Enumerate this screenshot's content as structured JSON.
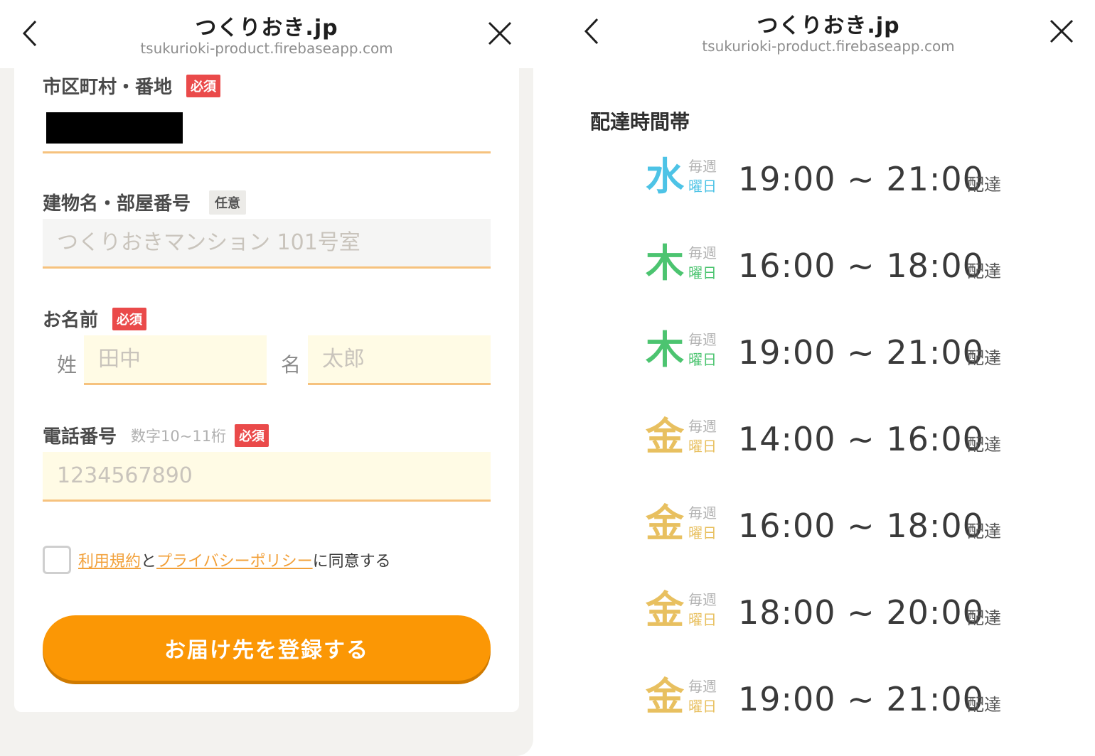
{
  "colors": {
    "accent": "#fb9705",
    "required_badge": "#ea4a4a",
    "input_border": "#f6c27e",
    "link": "#f2a13b",
    "wed": "#4dc3e6",
    "thu": "#4cc470",
    "fri": "#e8c060"
  },
  "left": {
    "header": {
      "title": "つくりおき.jp",
      "url": "tsukurioki-product.firebaseapp.com"
    },
    "form": {
      "city": {
        "label": "市区町村・番地",
        "badge": "必須"
      },
      "building": {
        "label": "建物名・部屋番号",
        "badge": "任意",
        "placeholder": "つくりおきマンション 101号室"
      },
      "name": {
        "label": "お名前",
        "badge": "必須",
        "last_prefix": "姓",
        "last_placeholder": "田中",
        "first_prefix": "名",
        "first_placeholder": "太郎"
      },
      "phone": {
        "label": "電話番号",
        "hint": "数字10~11桁",
        "badge": "必須",
        "placeholder": "1234567890"
      },
      "agree": {
        "terms_link": "利用規約",
        "and": "と",
        "privacy_link": "プライバシーポリシー",
        "suffix": "に同意する"
      },
      "submit_label": "お届け先を登録する"
    }
  },
  "right": {
    "header": {
      "title": "つくりおき.jp",
      "url": "tsukurioki-product.firebaseapp.com"
    },
    "section_title": "配達時間帯",
    "weekly_label": "毎週",
    "dayword_label": "曜日",
    "suffix_label": "配達",
    "slots": [
      {
        "day": "水",
        "color_key": "wed",
        "time": "19:00 ~ 21:00"
      },
      {
        "day": "木",
        "color_key": "thu",
        "time": "16:00 ~ 18:00"
      },
      {
        "day": "木",
        "color_key": "thu",
        "time": "19:00 ~ 21:00"
      },
      {
        "day": "金",
        "color_key": "fri",
        "time": "14:00 ~ 16:00"
      },
      {
        "day": "金",
        "color_key": "fri",
        "time": "16:00 ~ 18:00"
      },
      {
        "day": "金",
        "color_key": "fri",
        "time": "18:00 ~ 20:00"
      },
      {
        "day": "金",
        "color_key": "fri",
        "time": "19:00 ~ 21:00"
      }
    ]
  }
}
